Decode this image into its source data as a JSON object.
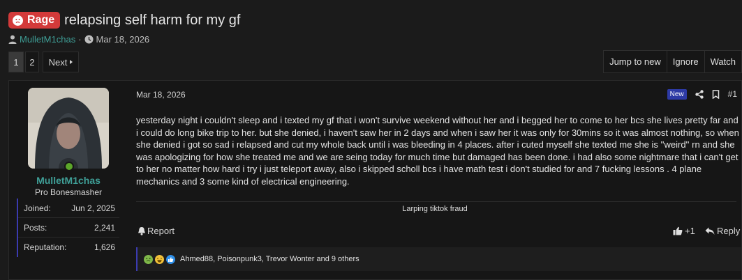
{
  "thread": {
    "prefix": "Rage",
    "prefix_color": "#d33a3a",
    "title": "relapsing self harm for my gf",
    "author": "MulletM1chas",
    "date": "Mar 18, 2026"
  },
  "pagination": {
    "current": "1",
    "pages": [
      "1",
      "2"
    ],
    "next_label": "Next"
  },
  "thread_actions": {
    "jump_label": "Jump to new",
    "ignore_label": "Ignore",
    "watch_label": "Watch"
  },
  "post": {
    "date": "Mar 18, 2026",
    "new_badge": "New",
    "number": "#1",
    "body": "yesterday night i couldn't sleep and i texted my gf that i won't survive weekend without her and i begged her to come to her bcs she lives pretty far and i could do long bike trip to her. but she denied, i haven't saw her in 2 days and when i saw her it was only for 30mins so it was almost nothing, so when she denied i got so sad i relapsed and cut my whole back until i was bleeding in 4 places. after i cuted myself she texted me she is ''weird'' rn and she was apologizing for how she treated me and we are seing today for much time but damaged has been done. i had also some nightmare that i can't get to her no matter how hard i try i just teleport away, also i skipped scholl bcs i have math test i don't studied for and 7 fucking lessons . 4 plane mechanics and 3 some kind of electrical engineering.",
    "signature": "Larping tiktok fraud",
    "report_label": "Report",
    "like_count": "+1",
    "reply_label": "Reply",
    "reactions": {
      "icons": [
        "sick-icon",
        "laugh-icon",
        "like-icon"
      ],
      "names": "Ahmed88, Poisonpunk3, Trevor Wonter and 9 others"
    }
  },
  "user": {
    "name": "MulletM1chas",
    "title": "Pro Bonesmasher",
    "online_color": "#5ca62a",
    "stats": [
      {
        "label": "Joined:",
        "value": "Jun 2, 2025"
      },
      {
        "label": "Posts:",
        "value": "2,241"
      },
      {
        "label": "Reputation:",
        "value": "1,626"
      }
    ]
  },
  "colors": {
    "accent_username": "#3f9f97",
    "accent_border": "#3b3bb0",
    "new_badge": "#2d3aa5"
  }
}
